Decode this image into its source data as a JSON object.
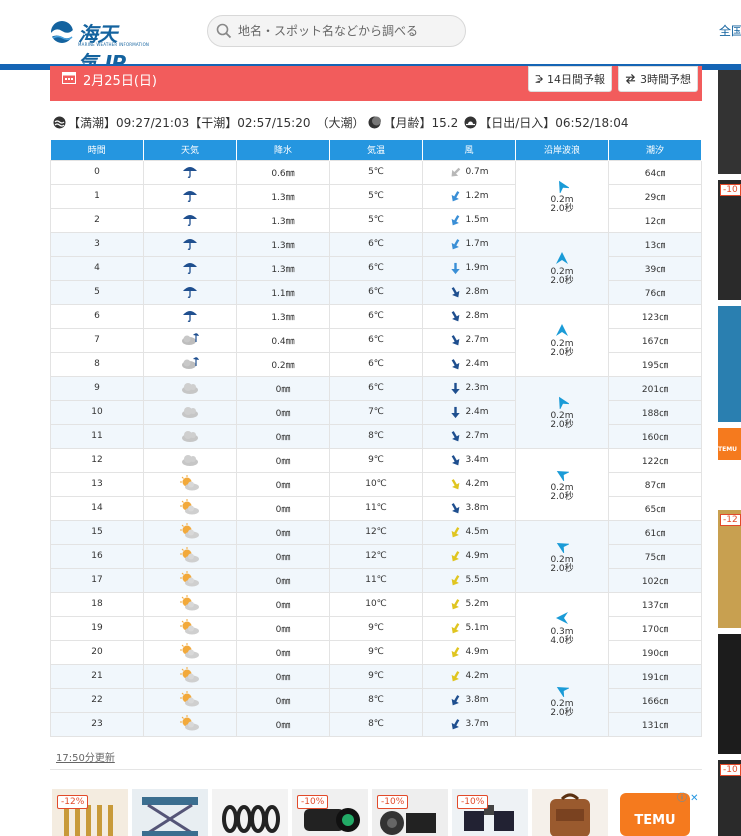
{
  "header": {
    "logo_text": "海天気.JP",
    "logo_sub": "MARINE WEATHER INFORMATION",
    "search_placeholder": "地名・スポット名などから調べる",
    "nav_label": "全国"
  },
  "date_bar": {
    "date": "2月25日(日)",
    "btn_14day": "14日間予報",
    "btn_3hour": "3時間予想"
  },
  "tide_info": {
    "high_label": "【満潮】",
    "high_value": "09:27/21:03",
    "low_label": "【干潮】",
    "low_value": "02:57/15:20",
    "tide_type": "（大潮）",
    "moon_label": "【月齢】",
    "moon_value": "15.2",
    "sun_label": "【日出/日入】",
    "sun_value": "06:52/18:04"
  },
  "table": {
    "headers": [
      "時間",
      "天気",
      "降水",
      "気温",
      "風",
      "沿岸波浪",
      "潮汐"
    ],
    "rows": [
      {
        "hour": "0",
        "weather": "rain",
        "precip": "0.6㎜",
        "temp": "5℃",
        "wind_dir": 315,
        "wind_color": "light",
        "wind": "0.7m",
        "tide": "64㎝"
      },
      {
        "hour": "1",
        "weather": "rain",
        "precip": "1.3㎜",
        "temp": "5℃",
        "wind_dir": 330,
        "wind_color": "blue",
        "wind": "1.2m",
        "tide": "29㎝"
      },
      {
        "hour": "2",
        "weather": "rain",
        "precip": "1.3㎜",
        "temp": "5℃",
        "wind_dir": 330,
        "wind_color": "blue",
        "wind": "1.5m",
        "tide": "12㎝"
      },
      {
        "hour": "3",
        "weather": "rain",
        "precip": "1.3㎜",
        "temp": "6℃",
        "wind_dir": 330,
        "wind_color": "blue",
        "wind": "1.7m",
        "tide": "13㎝"
      },
      {
        "hour": "4",
        "weather": "rain",
        "precip": "1.3㎜",
        "temp": "6℃",
        "wind_dir": 0,
        "wind_color": "blue",
        "wind": "1.9m",
        "tide": "39㎝"
      },
      {
        "hour": "5",
        "weather": "rain",
        "precip": "1.1㎜",
        "temp": "6℃",
        "wind_dir": 30,
        "wind_color": "navy",
        "wind": "2.8m",
        "tide": "76㎝"
      },
      {
        "hour": "6",
        "weather": "rain",
        "precip": "1.3㎜",
        "temp": "6℃",
        "wind_dir": 30,
        "wind_color": "navy",
        "wind": "2.8m",
        "tide": "123㎝"
      },
      {
        "hour": "7",
        "weather": "cloud-rain",
        "precip": "0.4㎜",
        "temp": "6℃",
        "wind_dir": 30,
        "wind_color": "navy",
        "wind": "2.7m",
        "tide": "167㎝"
      },
      {
        "hour": "8",
        "weather": "cloud-rain",
        "precip": "0.2㎜",
        "temp": "6℃",
        "wind_dir": 30,
        "wind_color": "navy",
        "wind": "2.4m",
        "tide": "195㎝"
      },
      {
        "hour": "9",
        "weather": "cloud",
        "precip": "0㎜",
        "temp": "6℃",
        "wind_dir": 0,
        "wind_color": "navy",
        "wind": "2.3m",
        "tide": "201㎝"
      },
      {
        "hour": "10",
        "weather": "cloud",
        "precip": "0㎜",
        "temp": "7℃",
        "wind_dir": 0,
        "wind_color": "navy",
        "wind": "2.4m",
        "tide": "188㎝"
      },
      {
        "hour": "11",
        "weather": "cloud",
        "precip": "0㎜",
        "temp": "8℃",
        "wind_dir": 30,
        "wind_color": "navy",
        "wind": "2.7m",
        "tide": "160㎝"
      },
      {
        "hour": "12",
        "weather": "cloud",
        "precip": "0㎜",
        "temp": "9℃",
        "wind_dir": 30,
        "wind_color": "navy",
        "wind": "3.4m",
        "tide": "122㎝"
      },
      {
        "hour": "13",
        "weather": "sun-cloud",
        "precip": "0㎜",
        "temp": "10℃",
        "wind_dir": 30,
        "wind_color": "yellow",
        "wind": "4.2m",
        "tide": "87㎝"
      },
      {
        "hour": "14",
        "weather": "sun-cloud",
        "precip": "0㎜",
        "temp": "11℃",
        "wind_dir": 30,
        "wind_color": "navy",
        "wind": "3.8m",
        "tide": "65㎝"
      },
      {
        "hour": "15",
        "weather": "sun-cloud",
        "precip": "0㎜",
        "temp": "12℃",
        "wind_dir": 330,
        "wind_color": "yellow",
        "wind": "4.5m",
        "tide": "61㎝"
      },
      {
        "hour": "16",
        "weather": "sun-cloud",
        "precip": "0㎜",
        "temp": "12℃",
        "wind_dir": 330,
        "wind_color": "yellow",
        "wind": "4.9m",
        "tide": "75㎝"
      },
      {
        "hour": "17",
        "weather": "sun-cloud",
        "precip": "0㎜",
        "temp": "11℃",
        "wind_dir": 330,
        "wind_color": "yellow",
        "wind": "5.5m",
        "tide": "102㎝"
      },
      {
        "hour": "18",
        "weather": "sun-cloud",
        "precip": "0㎜",
        "temp": "10℃",
        "wind_dir": 330,
        "wind_color": "yellow",
        "wind": "5.2m",
        "tide": "137㎝"
      },
      {
        "hour": "19",
        "weather": "sun-cloud",
        "precip": "0㎜",
        "temp": "9℃",
        "wind_dir": 330,
        "wind_color": "yellow",
        "wind": "5.1m",
        "tide": "170㎝"
      },
      {
        "hour": "20",
        "weather": "sun-cloud",
        "precip": "0㎜",
        "temp": "9℃",
        "wind_dir": 330,
        "wind_color": "yellow",
        "wind": "4.9m",
        "tide": "190㎝"
      },
      {
        "hour": "21",
        "weather": "sun-cloud",
        "precip": "0㎜",
        "temp": "9℃",
        "wind_dir": 330,
        "wind_color": "yellow",
        "wind": "4.2m",
        "tide": "191㎝"
      },
      {
        "hour": "22",
        "weather": "sun-cloud",
        "precip": "0㎜",
        "temp": "8℃",
        "wind_dir": 330,
        "wind_color": "navy",
        "wind": "3.8m",
        "tide": "166㎝"
      },
      {
        "hour": "23",
        "weather": "sun-cloud",
        "precip": "0㎜",
        "temp": "8℃",
        "wind_dir": 330,
        "wind_color": "navy",
        "wind": "3.7m",
        "tide": "131㎝"
      }
    ],
    "waves": [
      {
        "height": "0.2m",
        "period": "2.0秒",
        "dir": 60
      },
      {
        "height": "0.2m",
        "period": "2.0秒",
        "dir": 90
      },
      {
        "height": "0.2m",
        "period": "2.0秒",
        "dir": 90
      },
      {
        "height": "0.2m",
        "period": "2.0秒",
        "dir": 60
      },
      {
        "height": "0.2m",
        "period": "2.0秒",
        "dir": 30
      },
      {
        "height": "0.2m",
        "period": "2.0秒",
        "dir": 30
      },
      {
        "height": "0.3m",
        "period": "4.0秒",
        "dir": 0
      },
      {
        "height": "0.2m",
        "period": "2.0秒",
        "dir": 30
      }
    ]
  },
  "updated": "17:50分更新",
  "ads": {
    "badges": [
      "-12%",
      "-10%",
      "-10%",
      "-10%"
    ],
    "temu": "TEMU",
    "side_badges": [
      "-10",
      "-12",
      "-10"
    ],
    "side_temu": "TEMU"
  },
  "colors": {
    "brand": "#14639f",
    "header_bar": "#1565b5",
    "date_bar": "#f25c5c",
    "table_header": "#2596e0",
    "wave_arrow": "#1a9bd7",
    "wind_navy": "#1f4f8f",
    "wind_blue": "#3a8fd6",
    "wind_yellow": "#e0c520"
  }
}
